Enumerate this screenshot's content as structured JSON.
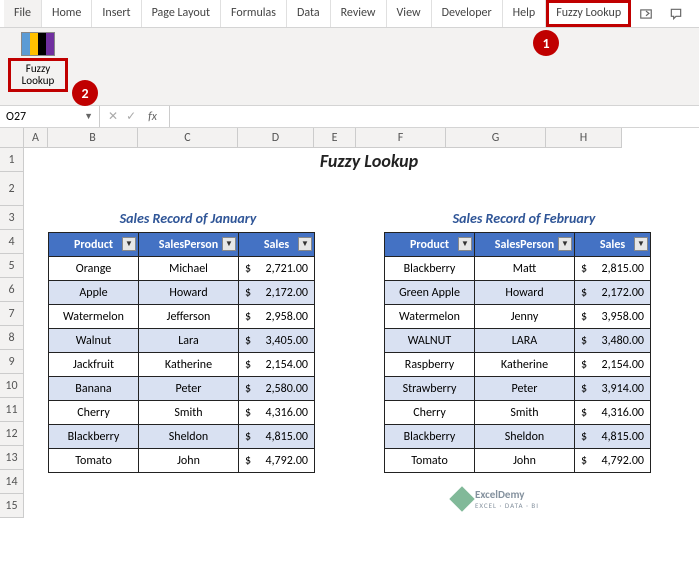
{
  "ribbon": {
    "tabs": [
      "File",
      "Home",
      "Insert",
      "Page Layout",
      "Formulas",
      "Data",
      "Review",
      "View",
      "Developer",
      "Help",
      "Fuzzy Lookup"
    ],
    "tool_label": "Fuzzy\nLookup"
  },
  "callouts": {
    "one": "1",
    "two": "2"
  },
  "namebox": {
    "ref": "O27",
    "fx": "fx"
  },
  "columns": [
    "A",
    "B",
    "C",
    "D",
    "E",
    "F",
    "G",
    "H"
  ],
  "rows": [
    "1",
    "2",
    "3",
    "4",
    "5",
    "6",
    "7",
    "8",
    "9",
    "10",
    "11",
    "12",
    "13",
    "14",
    "15"
  ],
  "title": "Fuzzy Lookup",
  "tables": {
    "jan": {
      "caption": "Sales Record of January",
      "headers": [
        "Product",
        "SalesPerson",
        "Sales"
      ],
      "data": [
        [
          "Orange",
          "Michael",
          "2,721.00"
        ],
        [
          "Apple",
          "Howard",
          "2,172.00"
        ],
        [
          "Watermelon",
          "Jefferson",
          "2,958.00"
        ],
        [
          "Walnut",
          "Lara",
          "3,405.00"
        ],
        [
          "Jackfruit",
          "Katherine",
          "2,154.00"
        ],
        [
          "Banana",
          "Peter",
          "2,580.00"
        ],
        [
          "Cherry",
          "Smith",
          "4,316.00"
        ],
        [
          "Blackberry",
          "Sheldon",
          "4,815.00"
        ],
        [
          "Tomato",
          "John",
          "4,792.00"
        ]
      ]
    },
    "feb": {
      "caption": "Sales Record of February",
      "headers": [
        "Product",
        "SalesPerson",
        "Sales"
      ],
      "data": [
        [
          "Blackberry",
          "Matt",
          "2,815.00"
        ],
        [
          "Green Apple",
          "Howard",
          "2,172.00"
        ],
        [
          "Watermelon",
          "Jenny",
          "3,958.00"
        ],
        [
          "WALNUT",
          "LARA",
          "3,480.00"
        ],
        [
          "Raspberry",
          "Katherine",
          "2,154.00"
        ],
        [
          "Strawberry",
          "Peter",
          "3,914.00"
        ],
        [
          "Cherry",
          "Smith",
          "4,316.00"
        ],
        [
          "Blackberry",
          "Sheldon",
          "4,815.00"
        ],
        [
          "Tomato",
          "John",
          "4,792.00"
        ]
      ]
    }
  },
  "watermark": {
    "brand": "ExcelDemy",
    "sub": "EXCEL · DATA · BI"
  }
}
